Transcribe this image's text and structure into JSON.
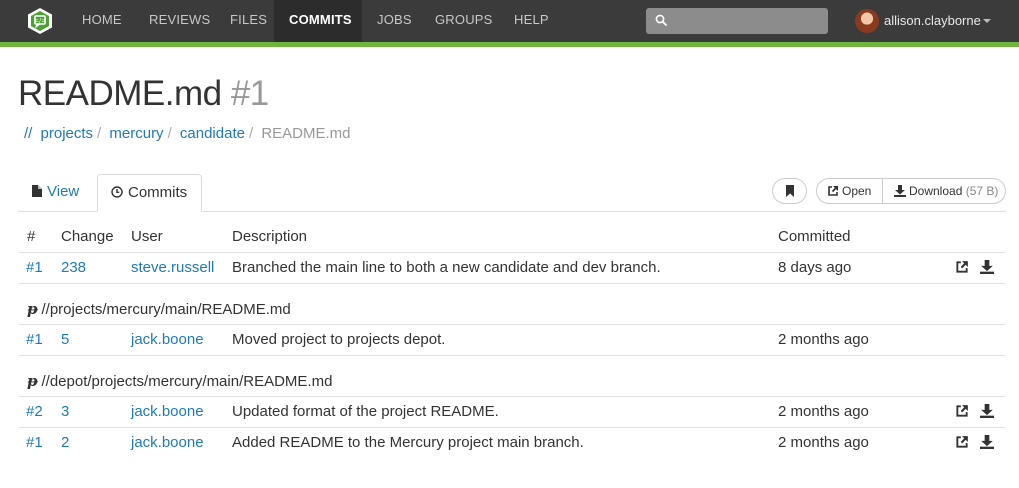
{
  "nav": {
    "items": [
      {
        "label": "HOME"
      },
      {
        "label": "REVIEWS"
      },
      {
        "label": "FILES"
      },
      {
        "label": "COMMITS"
      },
      {
        "label": "JOBS"
      },
      {
        "label": "GROUPS"
      },
      {
        "label": "HELP"
      }
    ],
    "active": "COMMITS",
    "search_placeholder": "",
    "username": "allison.clayborne"
  },
  "page": {
    "title": "README.md",
    "title_num": "#1"
  },
  "breadcrumb": {
    "root": "//",
    "items": [
      "projects",
      "mercury",
      "candidate"
    ],
    "current": "README.md"
  },
  "tabs": {
    "view": "View",
    "commits": "Commits"
  },
  "actions": {
    "open_label": "Open",
    "download_label": "Download",
    "download_size": "(57 B)"
  },
  "table": {
    "headers": {
      "num": "#",
      "change": "Change",
      "user": "User",
      "description": "Description",
      "committed": "Committed"
    },
    "rows": [
      {
        "num": "#1",
        "change": "238",
        "user": "steve.russell",
        "description": "Branched the main line to both a new candidate and dev branch.",
        "committed": "8 days ago"
      }
    ],
    "groups": [
      {
        "path": "//projects/mercury/main/README.md",
        "rows": [
          {
            "num": "#1",
            "change": "5",
            "user": "jack.boone",
            "description": "Moved project to projects depot.",
            "committed": "2 months ago"
          }
        ]
      },
      {
        "path": "//depot/projects/mercury/main/README.md",
        "rows": [
          {
            "num": "#2",
            "change": "3",
            "user": "jack.boone",
            "description": "Updated format of the project README.",
            "committed": "2 months ago"
          },
          {
            "num": "#1",
            "change": "2",
            "user": "jack.boone",
            "description": "Added README to the Mercury project main branch.",
            "committed": "2 months ago"
          }
        ]
      }
    ]
  },
  "colors": {
    "navbar": "#3b3b3b",
    "accent_green": "#6eb43f",
    "link": "#1f7ab8"
  }
}
